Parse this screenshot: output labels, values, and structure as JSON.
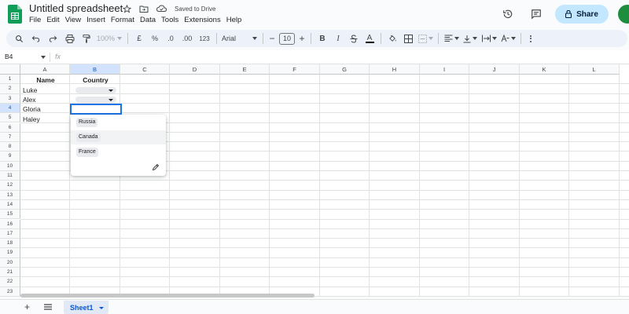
{
  "app": {
    "title": "Untitled spreadsheet",
    "saved_status": "Saved to Drive",
    "share_label": "Share",
    "menu": [
      "File",
      "Edit",
      "View",
      "Insert",
      "Format",
      "Data",
      "Tools",
      "Extensions",
      "Help"
    ]
  },
  "toolbar": {
    "zoom": "100%",
    "currency": "£",
    "percent": "%",
    "decimal_decrease": ".0",
    "decimal_increase": ".00",
    "number_format": "123",
    "font_family": "Arial",
    "font_size": "10",
    "bold": "B",
    "italic": "I",
    "text_color": "A"
  },
  "formula_bar": {
    "cell_ref": "B4",
    "fx_label": "fx",
    "value": ""
  },
  "grid": {
    "columns": [
      "A",
      "B",
      "C",
      "D",
      "E",
      "F",
      "G",
      "H",
      "I",
      "J",
      "K",
      "L"
    ],
    "selected_column": "B",
    "rows": [
      "1",
      "2",
      "3",
      "4",
      "5",
      "6",
      "7",
      "8",
      "9",
      "10",
      "11",
      "12",
      "13",
      "14",
      "15",
      "16",
      "17",
      "18",
      "19",
      "20",
      "21",
      "22",
      "23"
    ],
    "selected_row": "4",
    "cells": {
      "A1": "Name",
      "B1": "Country",
      "A2": "Luke",
      "A3": "Alex",
      "A4": "Gloria",
      "A5": "Haley"
    }
  },
  "dropdown": {
    "options": [
      "Russia",
      "Canada",
      "France"
    ],
    "hovered_option": "Canada",
    "edit_icon": "pencil-icon"
  },
  "sheets": {
    "tabs": [
      "Sheet1"
    ],
    "active": "Sheet1",
    "add_label": "+"
  },
  "colors": {
    "accent": "#1a73e8",
    "share_bg": "#c2e7ff",
    "sheets_green": "#0f9d58",
    "selected_header_bg": "#d3e3fd"
  }
}
